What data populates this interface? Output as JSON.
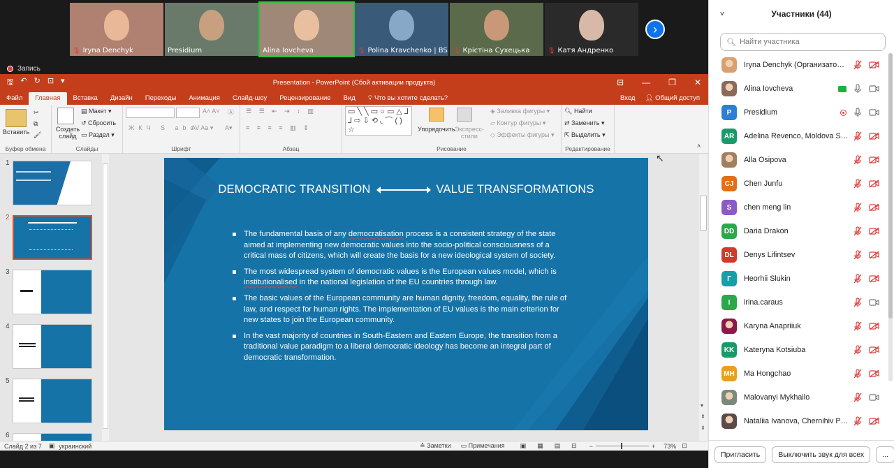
{
  "videos": [
    {
      "name": "Iryna Denchyk",
      "muted": true
    },
    {
      "name": "Presidium",
      "muted": false
    },
    {
      "name": "Alina Iovcheva",
      "muted": false,
      "active": true
    },
    {
      "name": "Polina Kravchenko | BS...",
      "muted": true
    },
    {
      "name": "Крістіна Сухецька",
      "muted": true
    },
    {
      "name": "Катя Андренко",
      "muted": true
    }
  ],
  "recording": {
    "label": "Запись"
  },
  "ppt": {
    "window_title": "Presentation - PowerPoint (Сбой активации продукта)",
    "tabs": [
      "Файл",
      "Главная",
      "Вставка",
      "Дизайн",
      "Переходы",
      "Анимация",
      "Слайд-шоу",
      "Рецензирование",
      "Вид"
    ],
    "tell_me": "Что вы хотите сделать?",
    "signin": "Вход",
    "share": "Общий доступ",
    "ribbon": {
      "paste": "Вставить",
      "create_slide": "Создать слайд",
      "layout": "Макет",
      "reset": "Сбросить",
      "section": "Раздел",
      "arrange": "Упорядочить",
      "express_styles": "Экспресс-стили",
      "fill": "Заливка фигуры",
      "outline": "Контур фигуры",
      "effects": "Эффекты фигуры",
      "find": "Найти",
      "replace": "Заменить",
      "select": "Выделить",
      "groups": {
        "clipboard": "Буфер обмена",
        "slides": "Слайды",
        "font": "Шрифт",
        "paragraph": "Абзац",
        "drawing": "Рисование",
        "editing": "Редактирование"
      }
    },
    "thumbnails": [
      "1",
      "2",
      "3",
      "4",
      "5",
      "6"
    ],
    "slide": {
      "title_left": "DEMOCRATIC TRANSITION",
      "title_right": "VALUE TRANSFORMATIONS",
      "bullets": [
        {
          "pre": "The fundamental basis of any ",
          "u": "democratisation",
          "post": " process is a consistent strategy of the state aimed at implementing new democratic values into the socio-political consciousness of a critical mass of citizens, which will create the basis for a new ideological system of society."
        },
        {
          "pre": "The most widespread system of democratic values is the European values model, which is ",
          "u": "institutionalised",
          "post": " in the national legislation of the EU countries through law."
        },
        {
          "pre": "The basic values of the European community are human dignity, freedom, equality, the rule of law, and respect for human rights. The implementation of EU values is the main criterion for new states to join the European community.",
          "u": "",
          "post": ""
        },
        {
          "pre": "In the vast majority of countries in South-Eastern and Eastern Europe, the transition from a traditional value paradigm to a liberal democratic ideology has become an integral part of democratic transformation.",
          "u": "",
          "post": ""
        }
      ]
    },
    "status": {
      "slide_of": "Слайд 2 из 7",
      "language": "украинский",
      "notes": "Заметки",
      "comments": "Примечания",
      "zoom": "73%"
    }
  },
  "participants": {
    "header": "Участники (44)",
    "search_placeholder": "Найти участника",
    "list": [
      {
        "name": "Iryna Denchyk (Организатор, я)",
        "initials": "",
        "color": "#d8a070",
        "photo": true,
        "mic": "off",
        "video": "off"
      },
      {
        "name": "Alina Iovcheva",
        "initials": "",
        "color": "#8a6a5a",
        "photo": true,
        "mic": "on",
        "video": "on",
        "share": true
      },
      {
        "name": "Presidium",
        "initials": "P",
        "color": "#2d7fd3",
        "photo": false,
        "mic": "on",
        "video": "on",
        "rec": true
      },
      {
        "name": "Adelina Revenco, Moldova State ...",
        "initials": "AR",
        "color": "#1a9a6a",
        "photo": false,
        "mic": "off",
        "video": "off"
      },
      {
        "name": "Alla Osipova",
        "initials": "",
        "color": "#a08060",
        "photo": true,
        "mic": "off",
        "video": "off"
      },
      {
        "name": "Chen Junfu",
        "initials": "CJ",
        "color": "#e0701a",
        "photo": false,
        "mic": "off",
        "video": "off"
      },
      {
        "name": "chen meng lin",
        "initials": "S",
        "color": "#8a5ac8",
        "photo": false,
        "mic": "off",
        "video": "off"
      },
      {
        "name": "Daria Drakon",
        "initials": "DD",
        "color": "#2aa84a",
        "photo": false,
        "mic": "off",
        "video": "off"
      },
      {
        "name": "Denys Lifintsev",
        "initials": "DL",
        "color": "#d03a2a",
        "photo": false,
        "mic": "off",
        "video": "off"
      },
      {
        "name": "Heorhii Slukin",
        "initials": "Г",
        "color": "#14a0a8",
        "photo": false,
        "mic": "off",
        "video": "off"
      },
      {
        "name": "irina.caraus",
        "initials": "I",
        "color": "#2aa84a",
        "photo": false,
        "mic": "off",
        "video": "on"
      },
      {
        "name": "Karyna Anapriiuk",
        "initials": "",
        "color": "#8a1a4a",
        "photo": true,
        "mic": "off",
        "video": "off"
      },
      {
        "name": "Kateryna Kotsiuba",
        "initials": "KK",
        "color": "#1a9a6a",
        "photo": false,
        "mic": "off",
        "video": "off"
      },
      {
        "name": "Ma Hongchao",
        "initials": "MH",
        "color": "#e8a020",
        "photo": false,
        "mic": "off",
        "video": "off"
      },
      {
        "name": "Malovanyi Mykhailo",
        "initials": "",
        "color": "#7a8a7a",
        "photo": true,
        "mic": "off",
        "video": "on"
      },
      {
        "name": "Nataliia Ivanova, Chernihiv Polyt...",
        "initials": "",
        "color": "#5a4a4a",
        "photo": true,
        "mic": "off",
        "video": "off"
      }
    ],
    "invite": "Пригласить",
    "mute_all": "Выключить звук для всех",
    "more": "..."
  }
}
